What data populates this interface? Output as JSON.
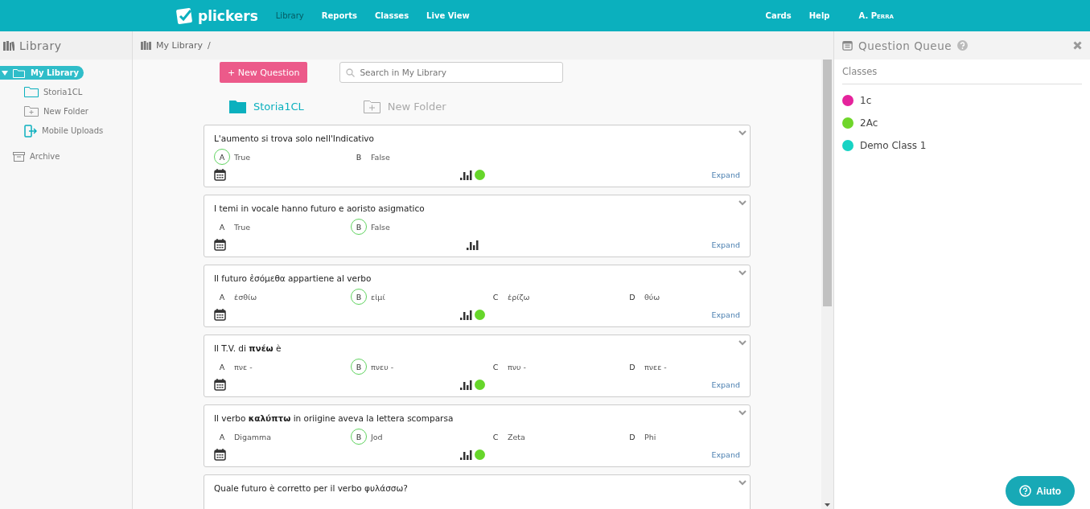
{
  "top_nav": {
    "logo": "plickers",
    "items": [
      {
        "label": "Library",
        "selected": true
      },
      {
        "label": "Reports",
        "selected": false
      },
      {
        "label": "Classes",
        "selected": false
      },
      {
        "label": "Live View",
        "selected": false
      }
    ],
    "right_items": [
      "Cards",
      "Help"
    ],
    "user": "A. Perra"
  },
  "sidebar": {
    "title": "Library",
    "items": [
      {
        "label": "My Library",
        "kind": "library",
        "selected": true,
        "expanded": true,
        "children": [
          {
            "label": "Storia1CL",
            "kind": "folder",
            "selected": false
          },
          {
            "label": "New Folder",
            "kind": "new-folder",
            "selected": false
          },
          {
            "label": "Mobile Uploads",
            "kind": "uploads",
            "selected": false
          }
        ]
      },
      {
        "label": "Archive",
        "kind": "archive",
        "selected": false
      }
    ]
  },
  "breadcrumb": {
    "items": [
      "My Library",
      "/"
    ]
  },
  "toolbar": {
    "new_button": "+ New Question",
    "search": {
      "placeholder": "Search in My Library"
    }
  },
  "folders": [
    {
      "label": "Storia1CL",
      "kind": "folder"
    },
    {
      "label": "New Folder",
      "kind": "new-folder"
    }
  ],
  "questions": [
    {
      "text": "L'aumento si trova solo nell'Indicativo",
      "choices": [
        {
          "letter": "A",
          "text": "True",
          "correct": true
        },
        {
          "letter": "B",
          "text": "False",
          "correct": false
        }
      ],
      "played": true,
      "expand": "Expand"
    },
    {
      "text": "I temi in vocale hanno futuro e aoristo asigmatico",
      "choices": [
        {
          "letter": "A",
          "text": "True",
          "correct": false
        },
        {
          "letter": "B",
          "text": "False",
          "correct": true
        }
      ],
      "played": false,
      "expand": "Expand"
    },
    {
      "text": "Il futuro ἐσόμεθα appartiene al verbo",
      "choices": [
        {
          "letter": "A",
          "text": "ἐσθίω",
          "correct": false
        },
        {
          "letter": "B",
          "text": "εἰμί",
          "correct": true
        },
        {
          "letter": "C",
          "text": "ἐρίζω",
          "correct": false
        },
        {
          "letter": "D",
          "text": "θύω",
          "correct": false
        }
      ],
      "played": true,
      "expand": "Expand"
    },
    {
      "text": "Il T.V. di **πνέω** è",
      "choices": [
        {
          "letter": "A",
          "text": "πνε -",
          "correct": false
        },
        {
          "letter": "B",
          "text": "πνευ -",
          "correct": true
        },
        {
          "letter": "C",
          "text": "πνυ -",
          "correct": false
        },
        {
          "letter": "D",
          "text": "πνεε -",
          "correct": false
        }
      ],
      "played": true,
      "expand": "Expand"
    },
    {
      "text": "Il verbo **καλύπτω** in oriigine aveva la lettera scomparsa",
      "choices": [
        {
          "letter": "A",
          "text": "Digamma",
          "correct": false
        },
        {
          "letter": "B",
          "text": "Jod",
          "correct": true
        },
        {
          "letter": "C",
          "text": "Zeta",
          "correct": false
        },
        {
          "letter": "D",
          "text": "Phi",
          "correct": false
        }
      ],
      "played": true,
      "expand": "Expand"
    },
    {
      "text": "Quale futuro è corretto per il verbo φυλάσσω?"
    }
  ],
  "queue": {
    "title": "Question Queue",
    "section": "Classes",
    "classes": [
      {
        "name": "1c",
        "color": "#e5239c"
      },
      {
        "name": "2Ac",
        "color": "#6fd62a"
      },
      {
        "name": "Demo Class 1",
        "color": "#17d3c4"
      }
    ]
  },
  "help_button": "Aiuto"
}
